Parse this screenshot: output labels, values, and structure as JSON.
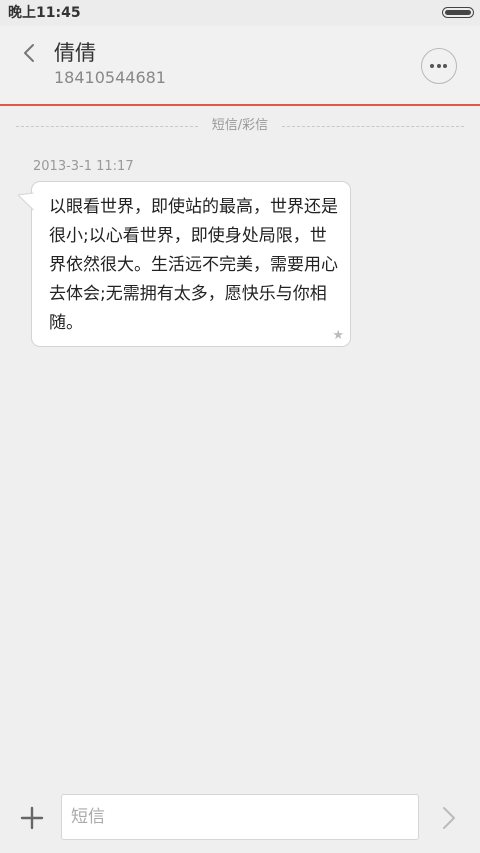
{
  "status_bar": {
    "time": "晚上11:45",
    "battery_icon": "battery-icon"
  },
  "header": {
    "back_icon": "chevron-left-icon",
    "contact_name": "倩倩",
    "contact_number": "18410544681",
    "more_icon": "more-horizontal-icon"
  },
  "conversation": {
    "divider_label": "短信/彩信",
    "messages": [
      {
        "timestamp": "2013-3-1 11:17",
        "text": "以眼看世界，即使站的最高，世界还是很小;以心看世界，即使身处局限，世界依然很大。生活远不完美，需要用心去体会;无需拥有太多，愿快乐与你相随。",
        "star_glyph": "★"
      }
    ]
  },
  "input_bar": {
    "add_icon": "plus-icon",
    "placeholder": "短信",
    "value": "",
    "send_icon": "chevron-right-icon"
  },
  "colors": {
    "accent": "#e2574c",
    "background": "#efefef",
    "bubble": "#ffffff"
  }
}
